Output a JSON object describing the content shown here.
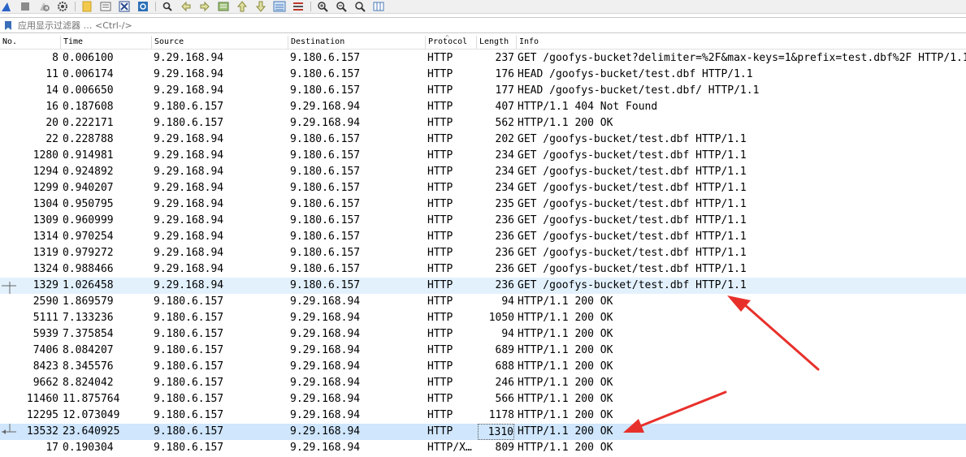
{
  "filter": {
    "placeholder": "应用显示过滤器 … <Ctrl-/>"
  },
  "columns": {
    "no": "No.",
    "time": "Time",
    "source": "Source",
    "destination": "Destination",
    "protocol": "Protocol",
    "length": "Length",
    "info": "Info"
  },
  "packets": [
    {
      "no": "8",
      "time": "0.006100",
      "src": "9.29.168.94",
      "dst": "9.180.6.157",
      "proto": "HTTP",
      "len": "237",
      "info": "GET /goofys-bucket?delimiter=%2F&max-keys=1&prefix=test.dbf%2F HTTP/1.1"
    },
    {
      "no": "11",
      "time": "0.006174",
      "src": "9.29.168.94",
      "dst": "9.180.6.157",
      "proto": "HTTP",
      "len": "176",
      "info": "HEAD /goofys-bucket/test.dbf HTTP/1.1"
    },
    {
      "no": "14",
      "time": "0.006650",
      "src": "9.29.168.94",
      "dst": "9.180.6.157",
      "proto": "HTTP",
      "len": "177",
      "info": "HEAD /goofys-bucket/test.dbf/ HTTP/1.1"
    },
    {
      "no": "16",
      "time": "0.187608",
      "src": "9.180.6.157",
      "dst": "9.29.168.94",
      "proto": "HTTP",
      "len": "407",
      "info": "HTTP/1.1 404 Not Found"
    },
    {
      "no": "20",
      "time": "0.222171",
      "src": "9.180.6.157",
      "dst": "9.29.168.94",
      "proto": "HTTP",
      "len": "562",
      "info": "HTTP/1.1 200 OK"
    },
    {
      "no": "22",
      "time": "0.228788",
      "src": "9.29.168.94",
      "dst": "9.180.6.157",
      "proto": "HTTP",
      "len": "202",
      "info": "GET /goofys-bucket/test.dbf HTTP/1.1"
    },
    {
      "no": "1280",
      "time": "0.914981",
      "src": "9.29.168.94",
      "dst": "9.180.6.157",
      "proto": "HTTP",
      "len": "234",
      "info": "GET /goofys-bucket/test.dbf HTTP/1.1"
    },
    {
      "no": "1294",
      "time": "0.924892",
      "src": "9.29.168.94",
      "dst": "9.180.6.157",
      "proto": "HTTP",
      "len": "234",
      "info": "GET /goofys-bucket/test.dbf HTTP/1.1"
    },
    {
      "no": "1299",
      "time": "0.940207",
      "src": "9.29.168.94",
      "dst": "9.180.6.157",
      "proto": "HTTP",
      "len": "234",
      "info": "GET /goofys-bucket/test.dbf HTTP/1.1"
    },
    {
      "no": "1304",
      "time": "0.950795",
      "src": "9.29.168.94",
      "dst": "9.180.6.157",
      "proto": "HTTP",
      "len": "235",
      "info": "GET /goofys-bucket/test.dbf HTTP/1.1"
    },
    {
      "no": "1309",
      "time": "0.960999",
      "src": "9.29.168.94",
      "dst": "9.180.6.157",
      "proto": "HTTP",
      "len": "236",
      "info": "GET /goofys-bucket/test.dbf HTTP/1.1"
    },
    {
      "no": "1314",
      "time": "0.970254",
      "src": "9.29.168.94",
      "dst": "9.180.6.157",
      "proto": "HTTP",
      "len": "236",
      "info": "GET /goofys-bucket/test.dbf HTTP/1.1"
    },
    {
      "no": "1319",
      "time": "0.979272",
      "src": "9.29.168.94",
      "dst": "9.180.6.157",
      "proto": "HTTP",
      "len": "236",
      "info": "GET /goofys-bucket/test.dbf HTTP/1.1"
    },
    {
      "no": "1324",
      "time": "0.988466",
      "src": "9.29.168.94",
      "dst": "9.180.6.157",
      "proto": "HTTP",
      "len": "236",
      "info": "GET /goofys-bucket/test.dbf HTTP/1.1"
    },
    {
      "no": "1329",
      "time": "1.026458",
      "src": "9.29.168.94",
      "dst": "9.180.6.157",
      "proto": "HTTP",
      "len": "236",
      "info": "GET /goofys-bucket/test.dbf HTTP/1.1",
      "state": "related",
      "marker": "request"
    },
    {
      "no": "2590",
      "time": "1.869579",
      "src": "9.180.6.157",
      "dst": "9.29.168.94",
      "proto": "HTTP",
      "len": "94",
      "info": "HTTP/1.1 200 OK"
    },
    {
      "no": "5111",
      "time": "7.133236",
      "src": "9.180.6.157",
      "dst": "9.29.168.94",
      "proto": "HTTP",
      "len": "1050",
      "info": "HTTP/1.1 200 OK"
    },
    {
      "no": "5939",
      "time": "7.375854",
      "src": "9.180.6.157",
      "dst": "9.29.168.94",
      "proto": "HTTP",
      "len": "94",
      "info": "HTTP/1.1 200 OK"
    },
    {
      "no": "7406",
      "time": "8.084207",
      "src": "9.180.6.157",
      "dst": "9.29.168.94",
      "proto": "HTTP",
      "len": "689",
      "info": "HTTP/1.1 200 OK"
    },
    {
      "no": "8423",
      "time": "8.345576",
      "src": "9.180.6.157",
      "dst": "9.29.168.94",
      "proto": "HTTP",
      "len": "688",
      "info": "HTTP/1.1 200 OK"
    },
    {
      "no": "9662",
      "time": "8.824042",
      "src": "9.180.6.157",
      "dst": "9.29.168.94",
      "proto": "HTTP",
      "len": "246",
      "info": "HTTP/1.1 200 OK"
    },
    {
      "no": "11460",
      "time": "11.875764",
      "src": "9.180.6.157",
      "dst": "9.29.168.94",
      "proto": "HTTP",
      "len": "566",
      "info": "HTTP/1.1 200 OK"
    },
    {
      "no": "12295",
      "time": "12.073049",
      "src": "9.180.6.157",
      "dst": "9.29.168.94",
      "proto": "HTTP",
      "len": "1178",
      "info": "HTTP/1.1 200 OK"
    },
    {
      "no": "13532",
      "time": "23.640925",
      "src": "9.180.6.157",
      "dst": "9.29.168.94",
      "proto": "HTTP",
      "len": "1310",
      "info": "HTTP/1.1 200 OK",
      "state": "selected",
      "marker": "response"
    },
    {
      "no": "17",
      "time": "0.190304",
      "src": "9.180.6.157",
      "dst": "9.29.168.94",
      "proto": "HTTP/X…",
      "len": "809",
      "info": "HTTP/1.1 200 OK"
    }
  ],
  "colors": {
    "related_row": "#e3f1fd",
    "selected_row": "#cfe6fc",
    "annotation_arrow": "#e8302b"
  },
  "toolbar_icons": [
    "shark-fin-start-icon",
    "stop-icon",
    "restart-icon",
    "options-gear-icon",
    "open-folder-icon",
    "file-set-icon",
    "close-file-icon",
    "reload-icon",
    "find-packet-icon",
    "go-back-icon",
    "go-forward-icon",
    "go-to-packet-icon",
    "go-first-icon",
    "go-last-icon",
    "auto-scroll-icon",
    "colorize-icon",
    "zoom-in-icon",
    "zoom-out-icon",
    "zoom-normal-icon",
    "resize-columns-icon"
  ]
}
